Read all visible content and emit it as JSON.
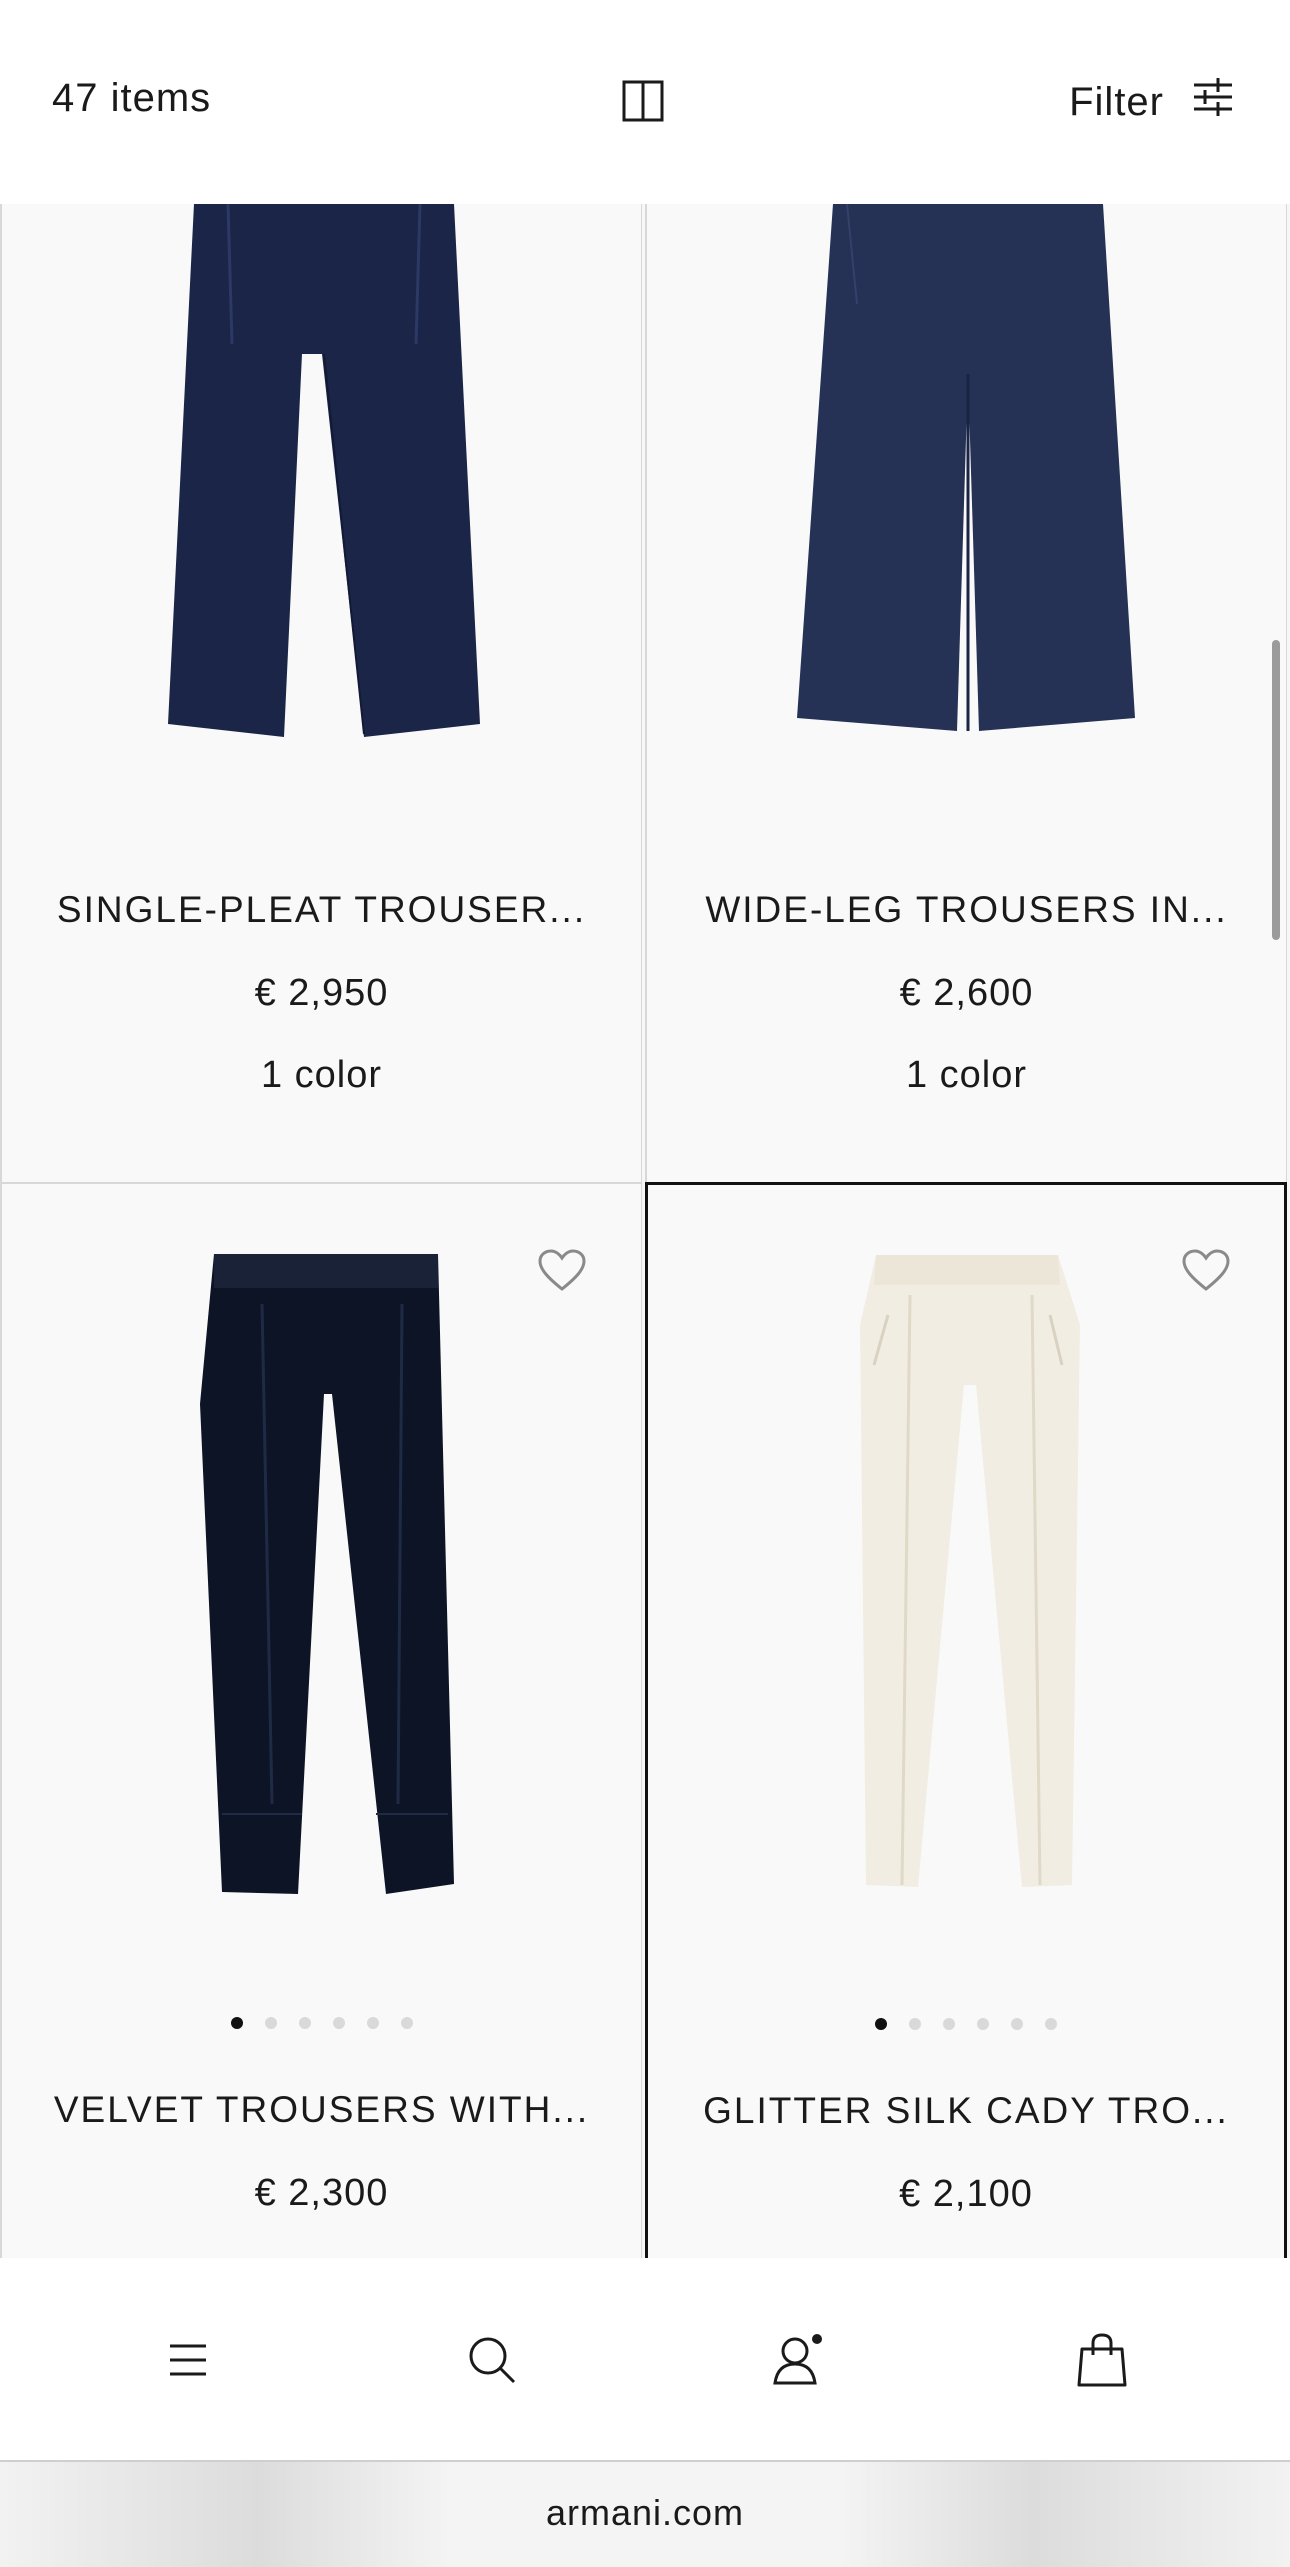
{
  "header": {
    "item_count": "47 items",
    "filter_label": "Filter"
  },
  "products": [
    {
      "name": "SINGLE-PLEAT TROUSER...",
      "price": "€ 2,950",
      "colors": "1 color",
      "color_hex": "#1b2547"
    },
    {
      "name": "WIDE-LEG TROUSERS IN...",
      "price": "€ 2,600",
      "colors": "1 color",
      "color_hex": "#253155"
    },
    {
      "name": "VELVET TROUSERS WITH...",
      "price": "€ 2,300",
      "color_hex": "#0d1426",
      "image_count": 6,
      "active_image": 1
    },
    {
      "name": "GLITTER SILK CADY TRO...",
      "price": "€ 2,100",
      "color_hex": "#f1ede3",
      "image_count": 6,
      "active_image": 1
    }
  ],
  "bottom_nav": {
    "items": [
      "menu-icon",
      "search-icon",
      "account-icon",
      "bag-icon"
    ]
  },
  "browser": {
    "url": "armani.com"
  }
}
